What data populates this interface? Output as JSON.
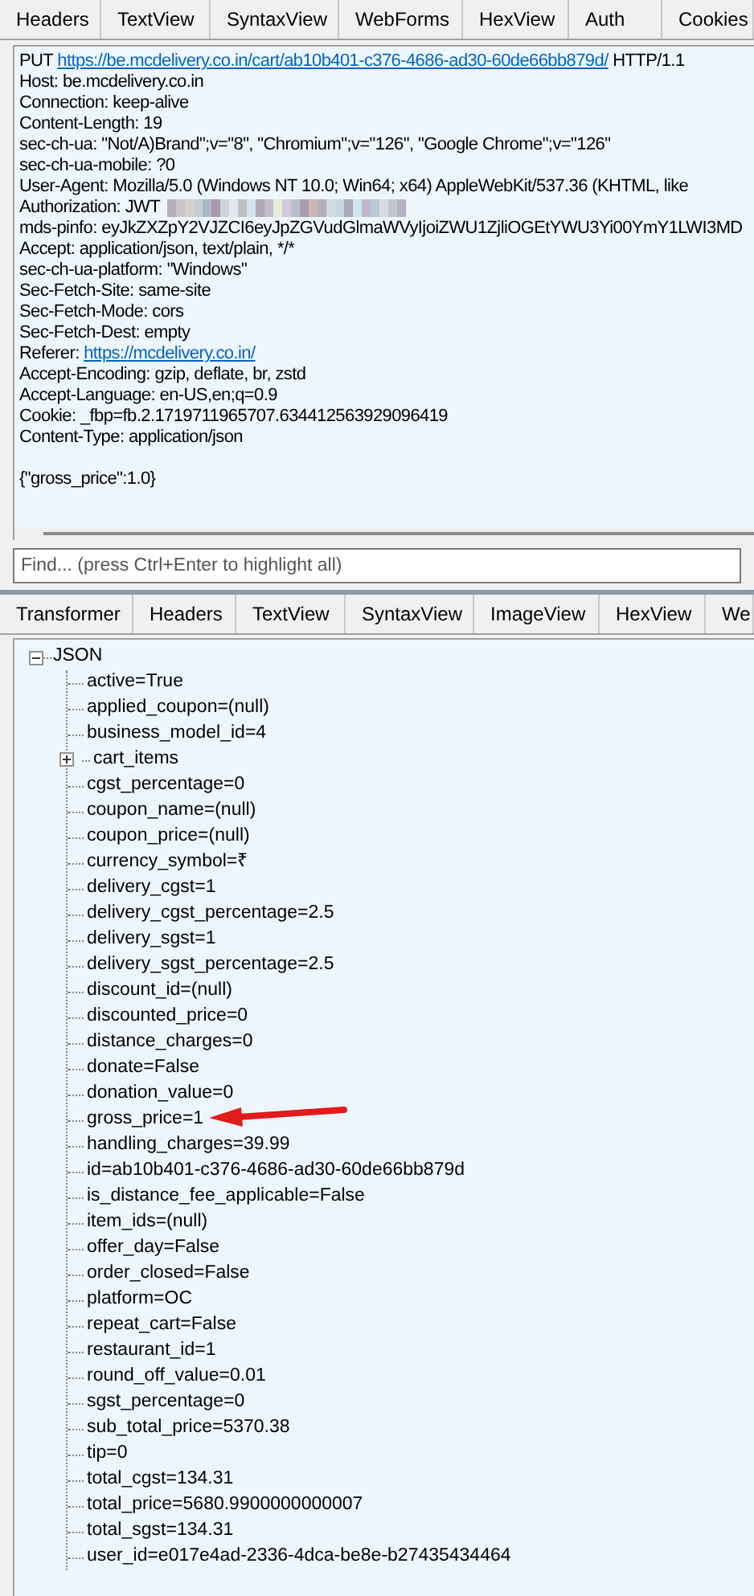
{
  "request_tabs": [
    {
      "label": "Headers",
      "selected": false
    },
    {
      "label": "TextView",
      "selected": false
    },
    {
      "label": "SyntaxView",
      "selected": false
    },
    {
      "label": "WebForms",
      "selected": false
    },
    {
      "label": "HexView",
      "selected": false
    },
    {
      "label": "Auth",
      "selected": false
    },
    {
      "label": "Cookies",
      "selected": false
    }
  ],
  "request": {
    "method": "PUT",
    "url": "https://be.mcdelivery.co.in/cart/ab10b401-c376-4686-ad30-60de66bb879d/",
    "version": "HTTP/1.1",
    "headers": [
      {
        "kind": "text",
        "name": "Host:",
        "value": "be.mcdelivery.co.in"
      },
      {
        "kind": "text",
        "name": "Connection:",
        "value": "keep-alive"
      },
      {
        "kind": "text",
        "name": "Content-Length:",
        "value": "19"
      },
      {
        "kind": "text",
        "name": "sec-ch-ua:",
        "value": "\"Not/A)Brand\";v=\"8\", \"Chromium\";v=\"126\", \"Google Chrome\";v=\"126\""
      },
      {
        "kind": "text",
        "name": "sec-ch-ua-mobile:",
        "value": "?0"
      },
      {
        "kind": "text",
        "name": "User-Agent:",
        "value": "Mozilla/5.0 (Windows NT 10.0; Win64; x64) AppleWebKit/537.36 (KHTML, like"
      },
      {
        "kind": "redacted",
        "name": "Authorization:",
        "value": "JWT"
      },
      {
        "kind": "text",
        "name": "mds-pinfo:",
        "value": "eyJkZXZpY2VJZCI6eyJpZGVudGlmaWVyIjoiZWU1ZjliOGEtYWU3Yi00YmY1LWI3MD"
      },
      {
        "kind": "text",
        "name": "Accept:",
        "value": "application/json, text/plain, */*"
      },
      {
        "kind": "text",
        "name": "sec-ch-ua-platform:",
        "value": "\"Windows\""
      },
      {
        "kind": "text",
        "name": "Sec-Fetch-Site:",
        "value": "same-site"
      },
      {
        "kind": "text",
        "name": "Sec-Fetch-Mode:",
        "value": "cors"
      },
      {
        "kind": "text",
        "name": "Sec-Fetch-Dest:",
        "value": "empty"
      },
      {
        "kind": "link",
        "name": "Referer:",
        "value": "https://mcdelivery.co.in/"
      },
      {
        "kind": "text",
        "name": "Accept-Encoding:",
        "value": "gzip, deflate, br, zstd"
      },
      {
        "kind": "text",
        "name": "Accept-Language:",
        "value": "en-US,en;q=0.9"
      },
      {
        "kind": "text",
        "name": "Cookie:",
        "value": "_fbp=fb.2.1719711965707.634412563929096419"
      },
      {
        "kind": "text",
        "name": "Content-Type:",
        "value": "application/json"
      }
    ],
    "body": "{\"gross_price\":1.0}"
  },
  "find": {
    "placeholder": "Find... (press Ctrl+Enter to highlight all)"
  },
  "response_tabs": [
    {
      "label": "Transformer",
      "selected": false
    },
    {
      "label": "Headers",
      "selected": false
    },
    {
      "label": "TextView",
      "selected": false
    },
    {
      "label": "SyntaxView",
      "selected": false
    },
    {
      "label": "ImageView",
      "selected": false
    },
    {
      "label": "HexView",
      "selected": false
    },
    {
      "label": "We",
      "selected": false
    }
  ],
  "tree": {
    "label": "JSON",
    "expanded": true,
    "children": [
      {
        "label": "active=True"
      },
      {
        "label": "applied_coupon=(null)"
      },
      {
        "label": "business_model_id=4"
      },
      {
        "label": "cart_items",
        "expanded": false
      },
      {
        "label": "cgst_percentage=0"
      },
      {
        "label": "coupon_name=(null)"
      },
      {
        "label": "coupon_price=(null)"
      },
      {
        "label": "currency_symbol=₹"
      },
      {
        "label": "delivery_cgst=1"
      },
      {
        "label": "delivery_cgst_percentage=2.5"
      },
      {
        "label": "delivery_sgst=1"
      },
      {
        "label": "delivery_sgst_percentage=2.5"
      },
      {
        "label": "discount_id=(null)"
      },
      {
        "label": "discounted_price=0"
      },
      {
        "label": "distance_charges=0"
      },
      {
        "label": "donate=False"
      },
      {
        "label": "donation_value=0"
      },
      {
        "label": "gross_price=1"
      },
      {
        "label": "handling_charges=39.99"
      },
      {
        "label": "id=ab10b401-c376-4686-ad30-60de66bb879d"
      },
      {
        "label": "is_distance_fee_applicable=False"
      },
      {
        "label": "item_ids=(null)"
      },
      {
        "label": "offer_day=False"
      },
      {
        "label": "order_closed=False"
      },
      {
        "label": "platform=OC"
      },
      {
        "label": "repeat_cart=False"
      },
      {
        "label": "restaurant_id=1"
      },
      {
        "label": "round_off_value=0.01"
      },
      {
        "label": "sgst_percentage=0"
      },
      {
        "label": "sub_total_price=5370.38"
      },
      {
        "label": "tip=0"
      },
      {
        "label": "total_cgst=134.31"
      },
      {
        "label": "total_price=5680.9900000000007"
      },
      {
        "label": "total_sgst=134.31"
      },
      {
        "label": "user_id=e017e4ad-2336-4dca-be8e-b27435434464"
      }
    ]
  }
}
